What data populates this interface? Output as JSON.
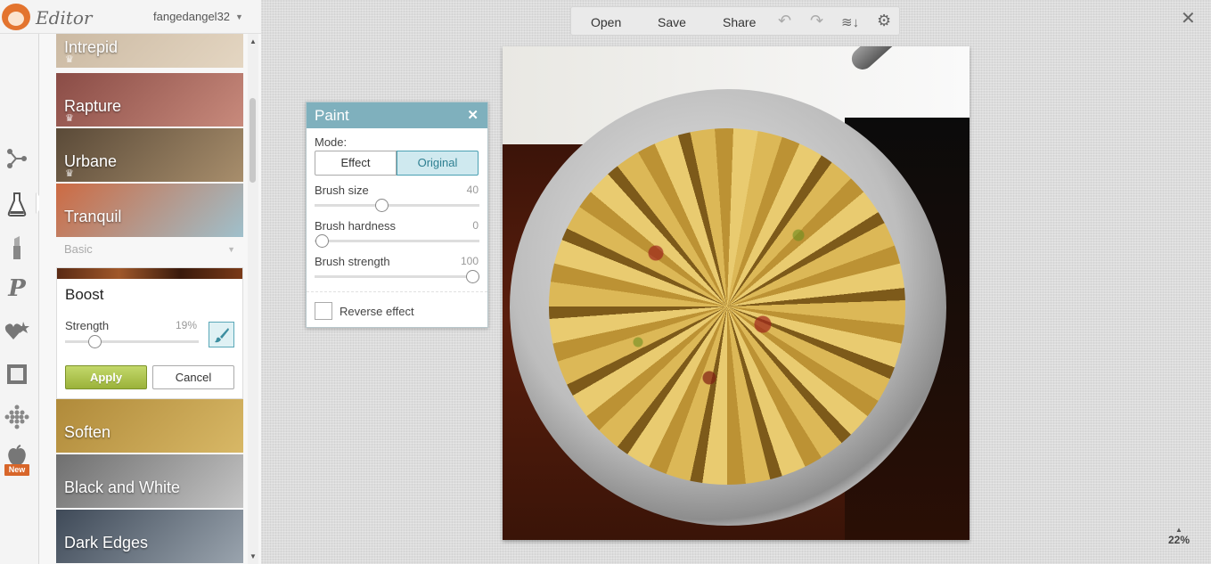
{
  "header": {
    "app_name": "Editor",
    "username": "fangedangel32"
  },
  "rail": {
    "tools": [
      "nodes-icon",
      "flask-icon",
      "lipstick-icon",
      "text-p-icon",
      "heart-sticker-icon",
      "frame-icon",
      "texture-icon",
      "apple-icon"
    ],
    "new_badge": "New"
  },
  "effects": [
    {
      "label": "Intrepid",
      "premium": true,
      "colors": [
        "#c9b7a0",
        "#e4d6c2"
      ]
    },
    {
      "label": "Rapture",
      "premium": true,
      "colors": [
        "#8a4c46",
        "#c88a7c"
      ]
    },
    {
      "label": "Urbane",
      "premium": true,
      "colors": [
        "#5a4a38",
        "#a88e6c"
      ]
    },
    {
      "label": "Tranquil",
      "premium": false,
      "colors": [
        "#cd6a42",
        "#9fc0cc"
      ]
    }
  ],
  "category": "Basic",
  "boost": {
    "title": "Boost",
    "strength_label": "Strength",
    "strength_value": "19%",
    "strength_fraction": 0.19,
    "apply": "Apply",
    "cancel": "Cancel"
  },
  "effects_below": [
    {
      "label": "Soften",
      "colors": [
        "#b08a3a",
        "#d8b866"
      ]
    },
    {
      "label": "Black and White",
      "colors": [
        "#6f6f6f",
        "#c4c4c4"
      ]
    },
    {
      "label": "Dark Edges",
      "colors": [
        "#3f4a58",
        "#9aa4ae"
      ]
    }
  ],
  "toolbar": {
    "open": "Open",
    "save": "Save",
    "share": "Share",
    "icons": [
      "undo-icon",
      "redo-icon",
      "layers-icon",
      "gear-icon"
    ]
  },
  "paint": {
    "title": "Paint",
    "mode_label": "Mode:",
    "mode_effect": "Effect",
    "mode_original": "Original",
    "brush_size_label": "Brush size",
    "brush_size_value": "40",
    "brush_hardness_label": "Brush hardness",
    "brush_hardness_value": "0",
    "brush_strength_label": "Brush strength",
    "brush_strength_value": "100",
    "reverse_label": "Reverse effect"
  },
  "zoom": "22%"
}
